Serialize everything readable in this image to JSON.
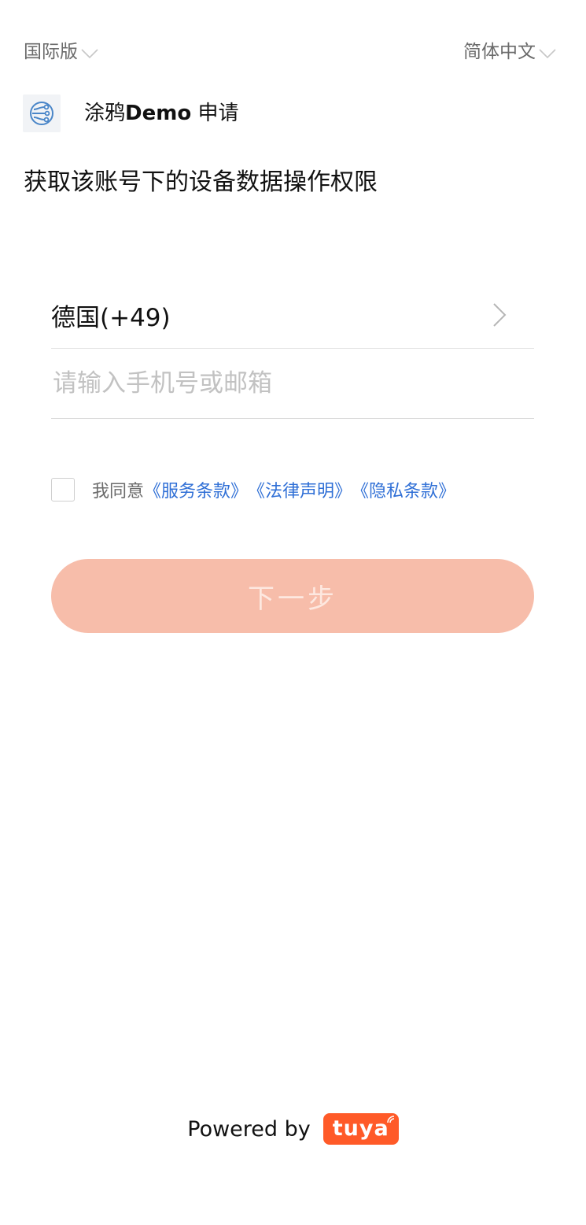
{
  "header": {
    "region_label": "国际版",
    "language_label": "简体中文"
  },
  "app": {
    "name": "涂鸦",
    "demo": "Demo",
    "request": " 申请",
    "logo_icon": "share-nodes-icon"
  },
  "permission": {
    "text": "获取该账号下的设备数据操作权限"
  },
  "form": {
    "country": "德国(+49)",
    "account_placeholder": "请输入手机号或邮箱",
    "account_value": ""
  },
  "agreement": {
    "prefix": "我同意",
    "terms": "《服务条款》",
    "legal": "《法律声明》",
    "privacy": "《隐私条款》",
    "checked": false,
    "link_color": "#2f6fd6"
  },
  "actions": {
    "next_label": "下一步",
    "button_color": "#f7bdaa"
  },
  "footer": {
    "powered_by": "Powered by",
    "brand": "tuya",
    "brand_color": "#ff5a28"
  }
}
